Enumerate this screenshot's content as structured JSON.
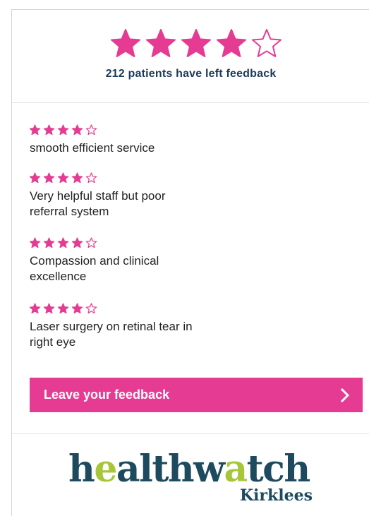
{
  "summary": {
    "rating": 4,
    "max_rating": 5,
    "feedback_count_text": "212 patients have left feedback"
  },
  "reviews": [
    {
      "rating": 4,
      "text_line1": "smooth efficient service",
      "text_line2": ""
    },
    {
      "rating": 4,
      "text_line1": "Very helpful staff but poor",
      "text_line2": "referral system"
    },
    {
      "rating": 4,
      "text_line1": "Compassion and clinical",
      "text_line2": "excellence"
    },
    {
      "rating": 4,
      "text_line1": "Laser surgery on retinal tear in",
      "text_line2": "right eye"
    }
  ],
  "cta": {
    "label": "Leave your feedback",
    "icon": "chevron-right-icon"
  },
  "logo": {
    "main_before": "h",
    "main_dot1": "e",
    "main_mid": "althw",
    "main_dot2": "a",
    "main_after": "tch",
    "sub": "Kirklees"
  },
  "colors": {
    "star_pink": "#e63b92",
    "cta_bg": "#e63b92",
    "summary_text": "#1d3a5a",
    "logo_navy": "#1d4a5e",
    "logo_green": "#a7c63a"
  }
}
